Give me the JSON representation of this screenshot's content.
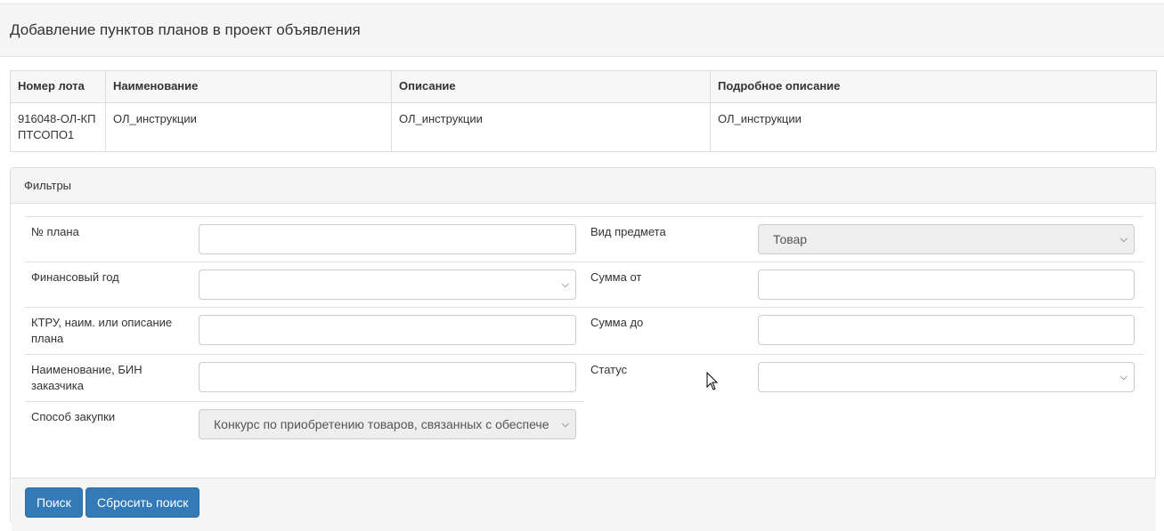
{
  "page": {
    "title": "Добавление пунктов планов в проект объявления"
  },
  "lot_table": {
    "headers": [
      "Номер лота",
      "Наименование",
      "Описание",
      "Подробное описание"
    ],
    "rows": [
      [
        "916048-ОЛ-КППТСОПО1",
        "ОЛ_инструкции",
        "ОЛ_инструкции",
        "ОЛ_инструкции"
      ]
    ]
  },
  "filters": {
    "heading": "Фильтры",
    "plan_number": {
      "label": "№ плана",
      "value": ""
    },
    "subject_type": {
      "label": "Вид предмета",
      "value": "Товар"
    },
    "fiscal_year": {
      "label": "Финансовый год",
      "value": ""
    },
    "sum_from": {
      "label": "Сумма от",
      "value": ""
    },
    "ktru": {
      "label": "КТРУ, наим. или описание плана",
      "value": ""
    },
    "sum_to": {
      "label": "Сумма до",
      "value": ""
    },
    "customer": {
      "label": "Наименование, БИН заказчика",
      "value": ""
    },
    "status": {
      "label": "Статус",
      "value": ""
    },
    "procurement_method": {
      "label": "Способ закупки",
      "value": "Конкурс по приобретению товаров, связанных с обеспече"
    }
  },
  "actions": {
    "search_label": "Поиск",
    "reset_label": "Сбросить поиск"
  },
  "icons": {
    "chevron": "chevron-down-icon",
    "cursor": "mouse-pointer-icon"
  },
  "colors": {
    "primary": "#337ab7",
    "border": "#dddddd",
    "panel_bg": "#f5f5f5"
  }
}
